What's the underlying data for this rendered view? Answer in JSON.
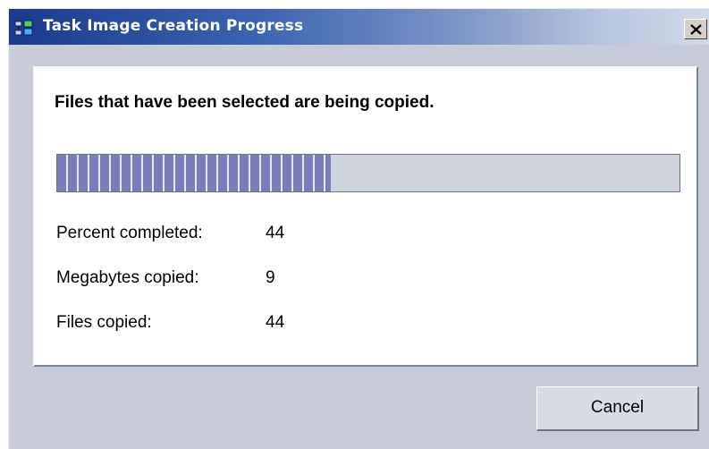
{
  "window": {
    "title": "Task Image Creation Progress",
    "app_icon": "network-computers-icon",
    "close_icon": "close-x-icon"
  },
  "content": {
    "message": "Files that have been selected are being copied.",
    "progress": {
      "fraction": 0.44
    },
    "stats": [
      {
        "label": "Percent completed:",
        "value": "44"
      },
      {
        "label": "Megabytes copied:",
        "value": "9"
      },
      {
        "label": "Files copied:",
        "value": "44"
      }
    ]
  },
  "buttons": {
    "cancel_label": "Cancel"
  },
  "colors": {
    "progress_fill": "#7b7eb6",
    "progress_track": "#cfd3dc",
    "dialog_bg": "#c7ccd8",
    "title_bar_start": "#1a3a8c"
  }
}
